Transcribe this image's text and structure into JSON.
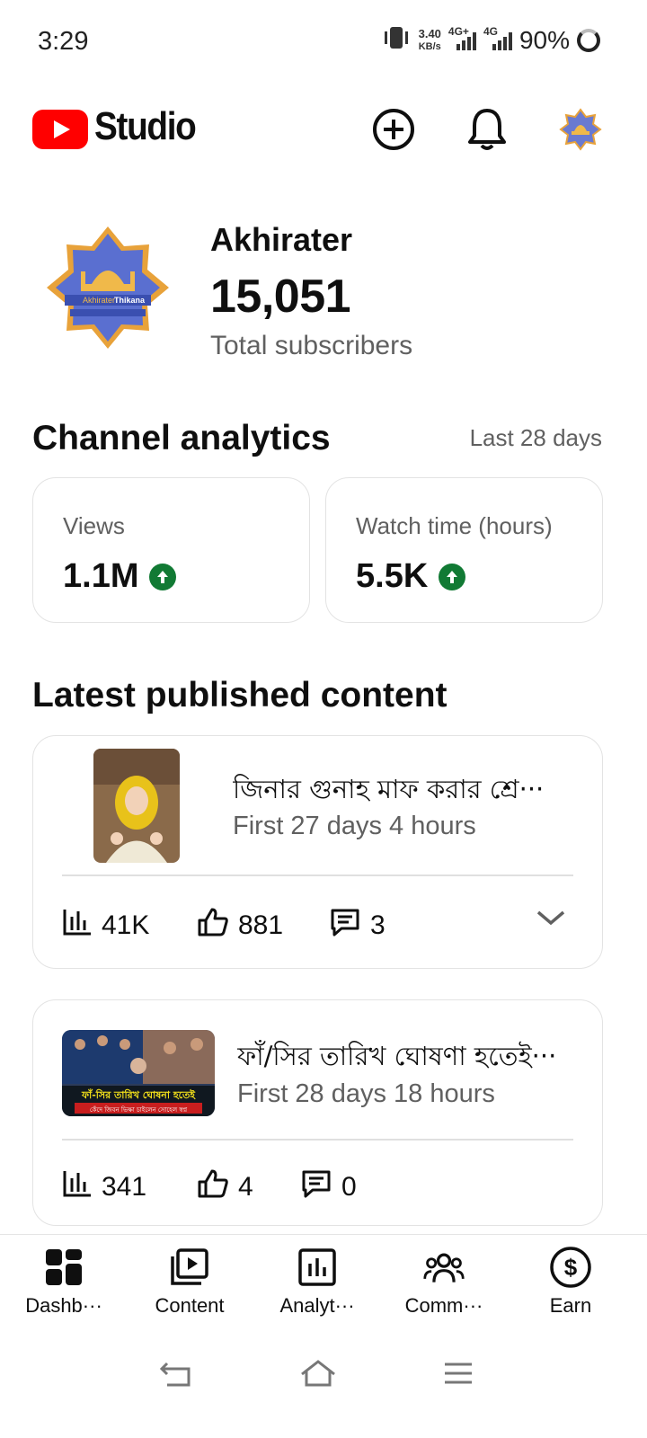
{
  "status_bar": {
    "time": "3:29",
    "net_speed_value": "3.40",
    "net_speed_unit": "KB/s",
    "network_1": "4G+",
    "network_2": "4G",
    "battery": "90%"
  },
  "app_bar": {
    "logo_text": "Studio",
    "icons": [
      "create-icon",
      "bell-icon",
      "channel-avatar"
    ]
  },
  "channel": {
    "name": "Akhirater",
    "subscribers": "15,051",
    "subscribers_label": "Total subscribers",
    "logo_text_1": "Akhirater",
    "logo_text_2": "Thikana"
  },
  "analytics": {
    "title": "Channel analytics",
    "period": "Last 28 days",
    "metrics": [
      {
        "label": "Views",
        "value": "1.1M",
        "trend": "up"
      },
      {
        "label": "Watch time (hours)",
        "value": "5.5K",
        "trend": "up"
      }
    ]
  },
  "latest": {
    "title": "Latest published content",
    "videos": [
      {
        "title": "জিনার গুনাহ মাফ করার শ্রে···",
        "meta": "First 27 days 4 hours",
        "views": "41K",
        "likes": "881",
        "comments": "3"
      },
      {
        "title": "ফাঁ/সির তারিখ ঘোষণা হতেই···",
        "meta": "First 28 days 18 hours",
        "views": "341",
        "likes": "4",
        "comments": "0",
        "thumb_caption_1": "ফাঁ-সির তারিখ ঘোষনা হতেই",
        "thumb_caption_2": "কেঁদে জিবন ভিক্ষা চাইলেন সোহেল স্বপ্ন"
      }
    ]
  },
  "bottom_nav": [
    {
      "label": "Dashb···",
      "icon": "dashboard-icon"
    },
    {
      "label": "Content",
      "icon": "content-icon"
    },
    {
      "label": "Analyt···",
      "icon": "analytics-icon"
    },
    {
      "label": "Comm···",
      "icon": "community-icon"
    },
    {
      "label": "Earn",
      "icon": "earn-icon"
    }
  ],
  "colors": {
    "brand_red": "#ff0000",
    "trend_green": "#117a34",
    "secondary_text": "#606060"
  }
}
